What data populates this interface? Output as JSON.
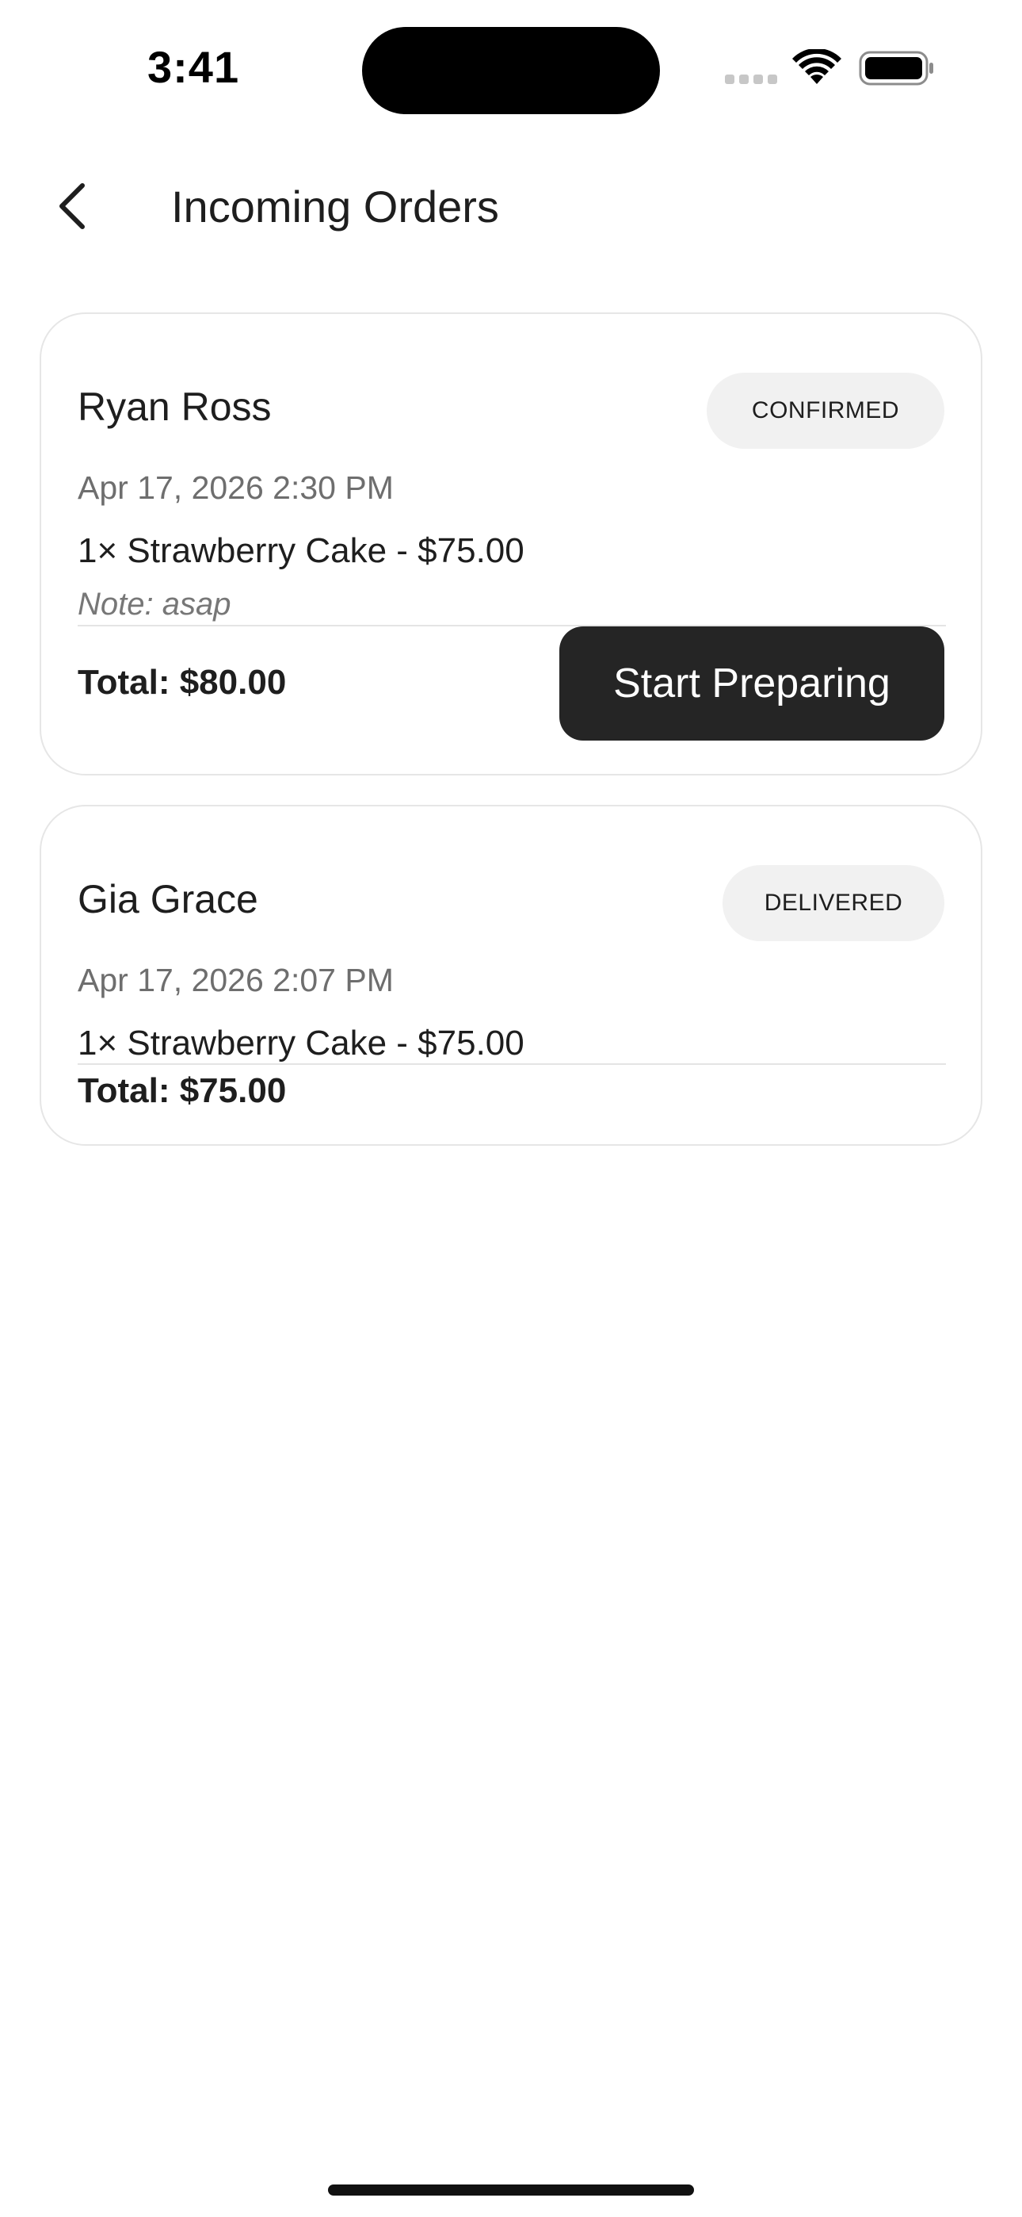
{
  "status_bar": {
    "time": "3:41"
  },
  "header": {
    "title": "Incoming Orders",
    "back_icon": "chevron-left-icon"
  },
  "orders": [
    {
      "customer": "Ryan Ross",
      "status": "CONFIRMED",
      "date": "Apr 17, 2026 2:30 PM",
      "item": "1× Strawberry Cake - $75.00",
      "note": "Note: asap",
      "total": "Total: $80.00",
      "action_label": "Start Preparing"
    },
    {
      "customer": "Gia Grace",
      "status": "DELIVERED",
      "date": "Apr 17, 2026 2:07 PM",
      "item": "1× Strawberry Cake - $75.00",
      "total": "Total: $75.00"
    }
  ],
  "colors": {
    "primary_button": "#252525",
    "badge_bg": "#f1f1f1",
    "card_border": "#e6e6e6"
  }
}
